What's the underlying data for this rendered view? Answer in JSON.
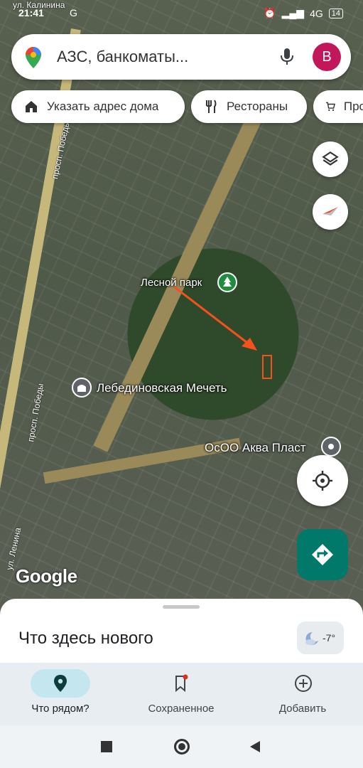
{
  "statusbar": {
    "time": "21:41",
    "carrier_icon": "G",
    "network": "4G",
    "battery": "14"
  },
  "search": {
    "placeholder": "АЗС, банкоматы...",
    "avatar_letter": "B"
  },
  "chips": [
    {
      "label": "Указать адрес дома",
      "icon": "home-icon"
    },
    {
      "label": "Рестораны",
      "icon": "restaurant-icon"
    },
    {
      "label": "Про",
      "icon": "cart-icon"
    }
  ],
  "map": {
    "labels": {
      "park": "Лесной парк",
      "mosque": "Лебединовская Мечеть",
      "company": "ОсОО Аква Пласт"
    },
    "streets": {
      "pobedy_top": "просп. Победы",
      "pobedy_bottom": "просп. Победы",
      "lenina": "ул. Ленина",
      "kalinina": "ул. Калинина"
    },
    "google_logo": "Google"
  },
  "sheet": {
    "title": "Что здесь нового",
    "weather_temp": "-7°"
  },
  "bottom_nav": [
    {
      "label": "Что рядом?",
      "icon": "location-pin-icon",
      "active": true
    },
    {
      "label": "Сохраненное",
      "icon": "bookmark-icon",
      "active": false
    },
    {
      "label": "Добавить",
      "icon": "add-circle-icon",
      "active": false
    }
  ],
  "colors": {
    "accent": "#00796b",
    "avatar": "#c2185b",
    "annotation": "#f4511e"
  }
}
